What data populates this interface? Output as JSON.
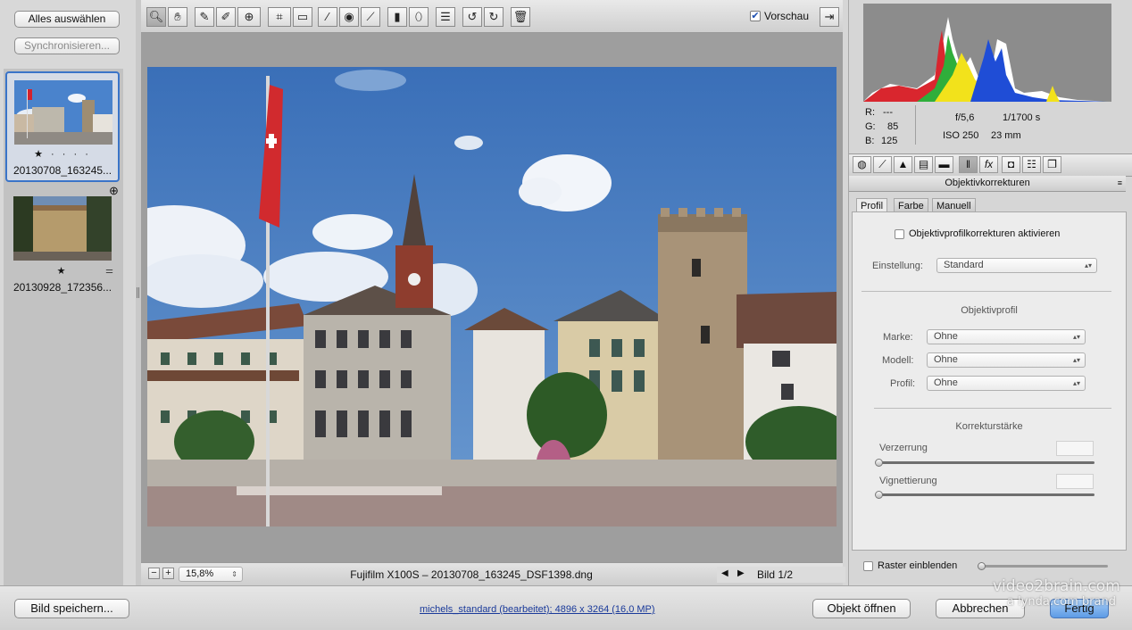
{
  "filmstrip": {
    "select_all": "Alles auswählen",
    "synchronize": "Synchronisieren...",
    "items": [
      {
        "filename": "20130708_163245...",
        "rating": "★ · · · ·"
      },
      {
        "filename": "20130928_172356...",
        "rating": "★"
      }
    ]
  },
  "toolbar": {
    "preview_label": "Vorschau",
    "preview_checked": true
  },
  "statusbar": {
    "zoom": "15,8%",
    "file_info": "Fujifilm X100S  –  20130708_163245_DSF1398.dng",
    "image_counter": "Bild 1/2"
  },
  "info": {
    "r_label": "R:",
    "r_value": "---",
    "g_label": "G:",
    "g_value": "85",
    "b_label": "B:",
    "b_value": "125",
    "aperture": "f/5,6",
    "shutter": "1/1700 s",
    "iso": "ISO 250",
    "focal": "23 mm"
  },
  "panel": {
    "title": "Objektivkorrekturen",
    "tabs": [
      "Profil",
      "Farbe",
      "Manuell"
    ],
    "enable_label": "Objektivprofilkorrekturen aktivieren",
    "setting_label": "Einstellung:",
    "setting_value": "Standard",
    "profile_section": "Objektivprofil",
    "make_label": "Marke:",
    "make_value": "Ohne",
    "model_label": "Modell:",
    "model_value": "Ohne",
    "profile_label": "Profil:",
    "profile_value": "Ohne",
    "strength_section": "Korrekturstärke",
    "distortion_label": "Verzerrung",
    "vignetting_label": "Vignettierung",
    "grid_label": "Raster einblenden"
  },
  "bottom": {
    "save_button": "Bild speichern...",
    "workflow_link": "michels_standard (bearbeitet); 4896 x 3264 (16,0 MP)",
    "open_object": "Objekt öffnen",
    "cancel": "Abbrechen",
    "done": "Fertig"
  },
  "watermark": {
    "brand": "video2brain.com",
    "sub": "a lynda.com brand"
  },
  "colors": {
    "accent": "#3a74c8",
    "sky": "#3f78c4"
  }
}
